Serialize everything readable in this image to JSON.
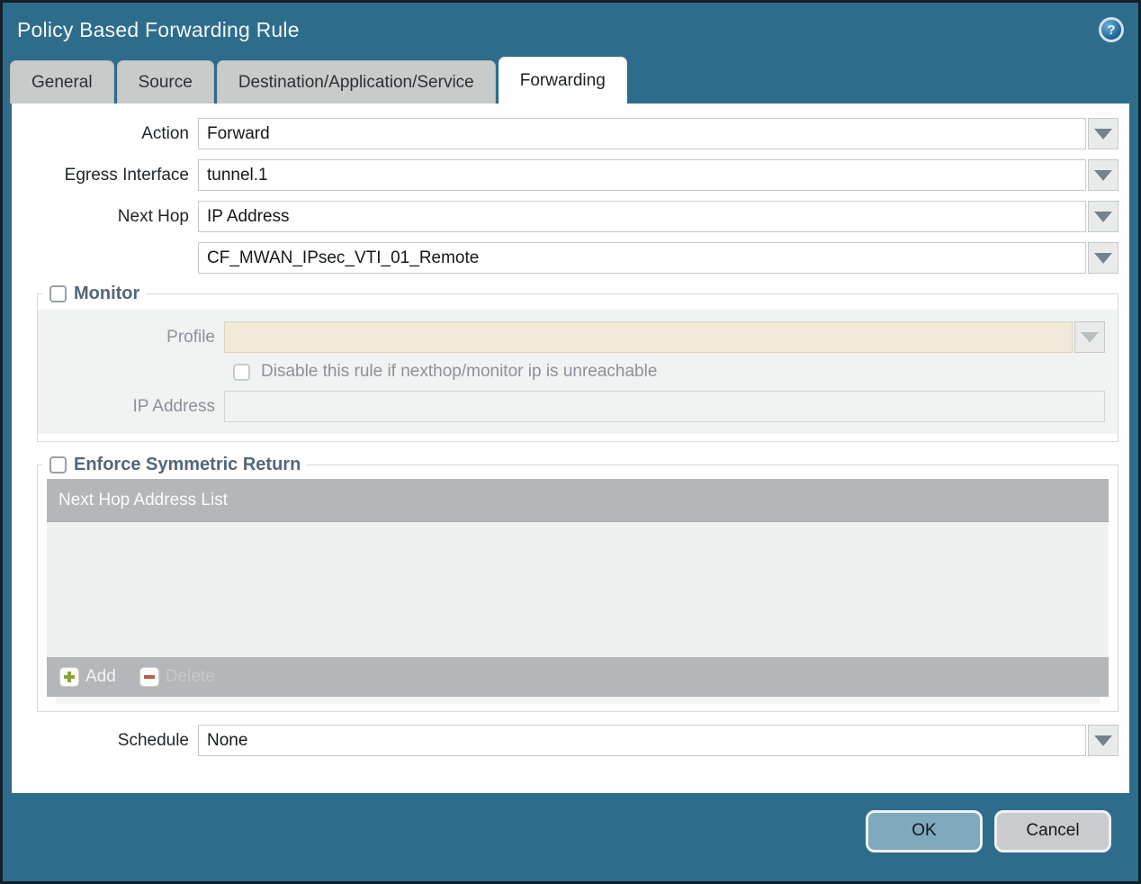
{
  "window": {
    "title": "Policy Based Forwarding Rule",
    "help_glyph": "?"
  },
  "tabs": [
    {
      "label": "General",
      "active": false
    },
    {
      "label": "Source",
      "active": false
    },
    {
      "label": "Destination/Application/Service",
      "active": false
    },
    {
      "label": "Forwarding",
      "active": true
    }
  ],
  "form": {
    "action": {
      "label": "Action",
      "value": "Forward"
    },
    "egress_interface": {
      "label": "Egress Interface",
      "value": "tunnel.1"
    },
    "next_hop": {
      "label": "Next Hop",
      "value": "IP Address"
    },
    "next_hop_address": {
      "value": "CF_MWAN_IPsec_VTI_01_Remote"
    },
    "schedule": {
      "label": "Schedule",
      "value": "None"
    }
  },
  "monitor": {
    "title": "Monitor",
    "checked": false,
    "profile": {
      "label": "Profile",
      "value": ""
    },
    "disable_rule_label": "Disable this rule if nexthop/monitor ip is unreachable",
    "disable_rule_checked": false,
    "ip_address": {
      "label": "IP Address",
      "value": ""
    }
  },
  "symmetric_return": {
    "title": "Enforce Symmetric Return",
    "checked": false,
    "table_header": "Next Hop Address List",
    "rows": [],
    "add_label": "Add",
    "delete_label": "Delete",
    "delete_enabled": false
  },
  "footer": {
    "ok_label": "OK",
    "cancel_label": "Cancel"
  },
  "colors": {
    "chrome_teal": "#2e6c8b",
    "window_border": "#141f29",
    "inactive_tab": "#c9cbcb",
    "legend_text": "#52677a",
    "disabled_cream": "#f1ead8",
    "table_gray": "#b3b7ba",
    "add_green": "#8ca33c",
    "delete_red": "#b2604e",
    "ok_button": "#7fa9bd",
    "cancel_button": "#c9cbce"
  }
}
